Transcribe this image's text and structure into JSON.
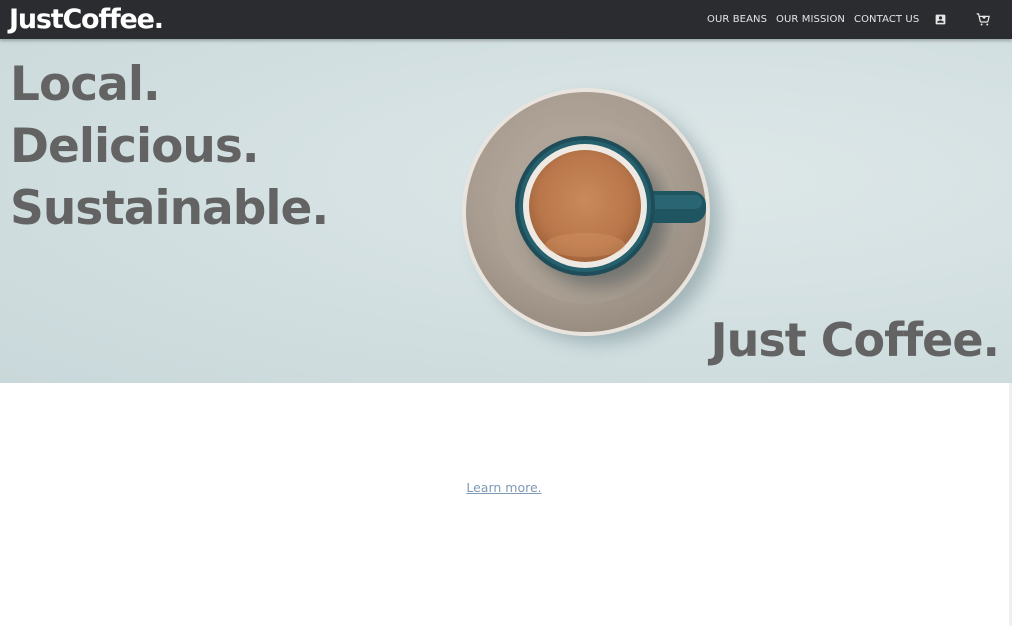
{
  "brand": {
    "logo_text": "JustCoffee."
  },
  "nav": {
    "links": [
      {
        "label": "OUR BEANS"
      },
      {
        "label": "OUR MISSION"
      },
      {
        "label": "CONTACT US"
      }
    ],
    "icons": {
      "account": "account-box-icon",
      "cart": "shopping-cart-icon"
    }
  },
  "hero": {
    "tagline": [
      "Local.",
      "Delicious.",
      "Sustainable."
    ],
    "brand_text": "Just Coffee."
  },
  "content": {
    "learn_more": "Learn more."
  },
  "colors": {
    "navbar": "#2a2c30",
    "hero_bg": "#d2dfe1",
    "hero_text": "#636363",
    "link": "#7f9ab4"
  }
}
